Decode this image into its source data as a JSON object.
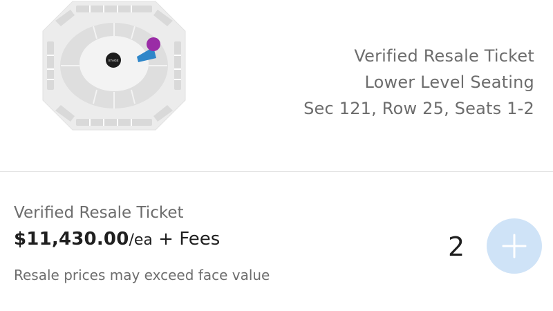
{
  "seat_map": {
    "stage_label": "STAGE",
    "colors": {
      "base": "#ececec",
      "sections": "#d5d5d5",
      "selected_section": "#2e86c9",
      "pin": "#9a2ca6",
      "stage": "#1c1c1c"
    }
  },
  "listing": {
    "title": "Verified Resale Ticket",
    "level": "Lower Level Seating",
    "location": "Sec 121, Row 25, Seats 1-2"
  },
  "ticket": {
    "type": "Verified Resale Ticket",
    "price": "$11,430.00",
    "per_unit": "/ea",
    "fees": " + Fees",
    "disclaimer": "Resale prices may exceed face value"
  },
  "quantity": {
    "value": "2",
    "add_icon": "plus-icon",
    "button_color": "#cfe3f7"
  }
}
